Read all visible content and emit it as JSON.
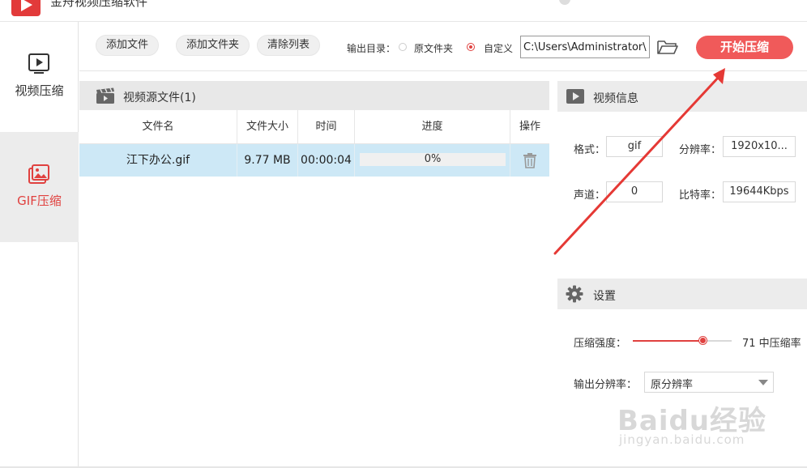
{
  "window": {
    "title": "金舟视频压缩软件"
  },
  "sidebar": {
    "items": [
      {
        "label": "视频压缩",
        "icon": "play-icon",
        "active": false
      },
      {
        "label": "GIF压缩",
        "icon": "image-icon",
        "active": true
      }
    ]
  },
  "toolbar": {
    "add_file": "添加文件",
    "add_folder": "添加文件夹",
    "clear_list": "清除列表",
    "output_dir_label": "输出目录：",
    "option_source": "原文件夹",
    "option_custom": "自定义",
    "selected_option": "自定义",
    "path_value": "C:\\Users\\Administrator\\",
    "folder_icon": "folder-open-icon",
    "start_button": "开始压缩"
  },
  "files_panel": {
    "title": "视频源文件(1)",
    "columns": [
      "文件名",
      "文件大小",
      "时间",
      "进度",
      "操作"
    ],
    "rows": [
      {
        "name": "江下办公.gif",
        "size": "9.77 MB",
        "time": "00:00:04",
        "progress_text": "0%",
        "progress": 0,
        "action_icon": "trash-icon"
      }
    ]
  },
  "video_info": {
    "title": "视频信息",
    "format_label": "格式：",
    "format_value": "gif",
    "resolution_label": "分辨率：",
    "resolution_value": "1920x10...",
    "channel_label": "声道：",
    "channel_value": "0",
    "bitrate_label": "比特率：",
    "bitrate_value": "19644Kbps"
  },
  "settings": {
    "title": "设置",
    "strength_label": "压缩强度：",
    "strength_value": 71,
    "strength_text": "71 中压缩率",
    "output_res_label": "输出分辨率：",
    "output_res_value": "原分辨率"
  },
  "watermark": {
    "brand": "Baidu经验",
    "url": "jingyan.baidu.com"
  },
  "colors": {
    "accent": "#e0413f",
    "start_button": "#f05a5a",
    "selected_row": "#cde8f6",
    "header_bg": "#e8e8e8"
  }
}
